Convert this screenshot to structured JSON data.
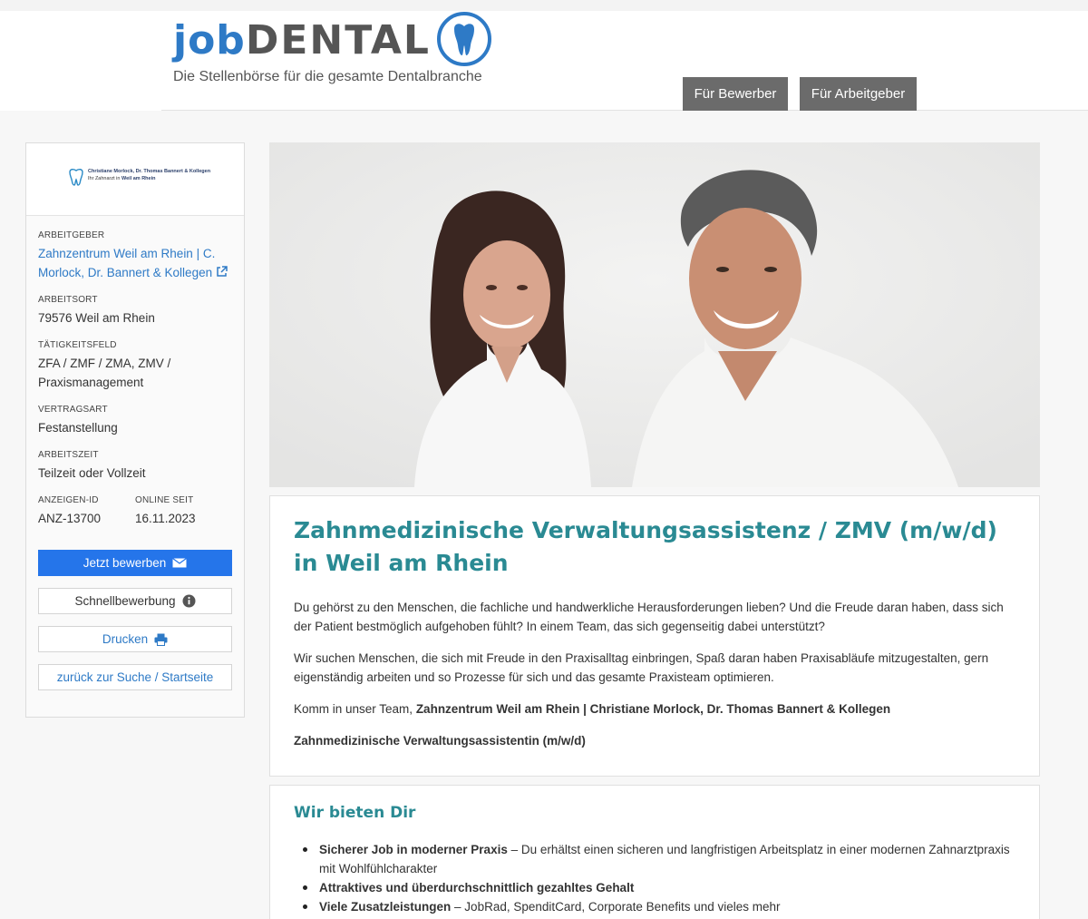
{
  "header": {
    "logo_job": "job",
    "logo_dental": "DENTAL",
    "tagline": "Die Stellenbörse für die gesamte Dentalbranche",
    "nav": {
      "bewerber": "Für Bewerber",
      "arbeitgeber": "Für Arbeitgeber"
    },
    "icon": "tooth-icon",
    "brand_color": "#2e7ac6"
  },
  "sidebar": {
    "company_logo": {
      "line1": "Christiane Morlock, Dr. Thomas Bannert & Kollegen",
      "line2_prefix": "Ihr Zahnarzt in ",
      "line2_bold": "Weil am Rhein"
    },
    "employer": {
      "label": "ARBEITGEBER",
      "value": "Zahnzentrum Weil am Rhein | C. Morlock, Dr. Bannert & Kollegen"
    },
    "location": {
      "label": "ARBEITSORT",
      "value": "79576 Weil am Rhein"
    },
    "field": {
      "label": "TÄTIGKEITSFELD",
      "value": "ZFA / ZMF / ZMA, ZMV / Praxismanagement"
    },
    "contract": {
      "label": "VERTRAGSART",
      "value": "Festanstellung"
    },
    "worktime": {
      "label": "ARBEITSZEIT",
      "value": "Teilzeit oder Vollzeit"
    },
    "ad_id": {
      "label": "ANZEIGEN-ID",
      "value": "ANZ-13700"
    },
    "online_since": {
      "label": "ONLINE SEIT",
      "value": "16.11.2023"
    },
    "buttons": {
      "apply": "Jetzt bewerben",
      "quick_apply": "Schnellbewerbung",
      "print": "Drucken",
      "back": "zurück zur Suche / Startseite"
    }
  },
  "job": {
    "title": "Zahnmedizinische Verwaltungsassistenz / ZMV (m/w/d) in Weil am Rhein",
    "intro1": "Du gehörst zu den Menschen, die fachliche und handwerkliche Herausforderungen lieben? Und die Freude daran haben, dass sich der Patient bestmöglich aufgehoben fühlt? In einem Team, das sich gegenseitig dabei unterstützt?",
    "intro2": "Wir suchen Menschen, die sich mit Freude in den Praxisalltag einbringen, Spaß daran haben Praxisabläufe mitzugestalten, gern eigenständig arbeiten und so Prozesse für sich und das gesamte Praxisteam optimieren.",
    "team_prefix": "Komm in unser Team, ",
    "team_name": "Zahnzentrum Weil am Rhein | Christiane Morlock, Dr. Thomas Bannert & Kollegen",
    "position": "Zahnmedizinische Verwaltungsassistentin (m/w/d)"
  },
  "offer": {
    "title": "Wir bieten Dir",
    "items": [
      {
        "bold": "Sicherer Job in moderner Praxis",
        "rest": " – Du erhältst einen sicheren und langfristigen Arbeitsplatz in einer modernen Zahnarztpraxis mit Wohlfühlcharakter"
      },
      {
        "bold": "Attraktives und überdurchschnittlich gezahltes Gehalt",
        "rest": ""
      },
      {
        "bold": "Viele Zusatzleistungen",
        "rest": " – JobRad, SpenditCard, Corporate Benefits und vieles mehr"
      }
    ]
  }
}
